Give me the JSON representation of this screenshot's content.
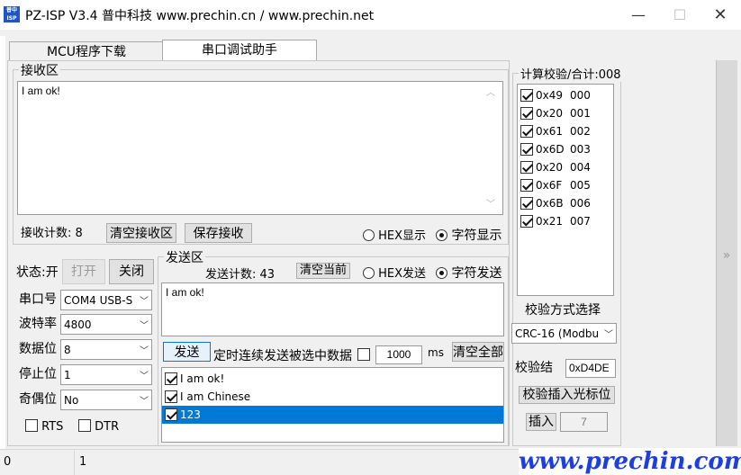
{
  "window": {
    "title": "PZ-ISP V3.4 普中科技 www.prechin.cn / www.prechin.net",
    "icon_text": "普中ISP",
    "min": "—",
    "max": "☐",
    "close": "✕"
  },
  "tabs": [
    "MCU程序下载",
    "串口调试助手"
  ],
  "receive": {
    "group_title": "接收区",
    "content": "I am ok!",
    "count_label": "接收计数: 8",
    "clear_button": "清空接收区",
    "save_button": "保存接收",
    "hex_label": "HEX显示",
    "char_label": "字符显示"
  },
  "send": {
    "group_title": "发送区",
    "count_label": "发送计数: 43",
    "clear_current_button": "清空当前",
    "hex_label": "HEX发送",
    "char_label": "字符发送",
    "content": "I am ok!",
    "send_button": "发送",
    "timer_label": "定时连续发送被选中数据",
    "interval_value": "1000",
    "interval_unit": "ms",
    "clear_all_button": "清空全部",
    "items": [
      {
        "label": "I am ok!",
        "checked": true,
        "selected": false
      },
      {
        "label": "I am Chinese",
        "checked": true,
        "selected": false
      },
      {
        "label": "123",
        "checked": true,
        "selected": true
      }
    ]
  },
  "port": {
    "status_label": "状态:开",
    "open_button": "打开",
    "close_button": "关闭",
    "fields": [
      {
        "label": "串口号",
        "value": "COM4  USB-S"
      },
      {
        "label": "波特率",
        "value": "4800"
      },
      {
        "label": "数据位",
        "value": "8"
      },
      {
        "label": "停止位",
        "value": "1"
      },
      {
        "label": "奇偶位",
        "value": "No"
      }
    ],
    "rts_label": "RTS",
    "dtr_label": "DTR"
  },
  "checksum": {
    "title": "计算校验/合计:008",
    "rows": [
      {
        "hex": "0x49",
        "idx": "000"
      },
      {
        "hex": "0x20",
        "idx": "001"
      },
      {
        "hex": "0x61",
        "idx": "002"
      },
      {
        "hex": "0x6D",
        "idx": "003"
      },
      {
        "hex": "0x20",
        "idx": "004"
      },
      {
        "hex": "0x6F",
        "idx": "005"
      },
      {
        "hex": "0x6B",
        "idx": "006"
      },
      {
        "hex": "0x21",
        "idx": "007"
      }
    ],
    "method_label": "校验方式选择",
    "method_value": "CRC-16 (Modbu",
    "result_label": "校验结",
    "result_value": "0xD4DE",
    "insert_cursor_button": "校验插入光标位",
    "insert_button": "插入",
    "insert_value": "7"
  },
  "statusbar": {
    "left": "0",
    "right": "1"
  },
  "brand": "www.prechin.com",
  "scroll_arrows": "»",
  "colors": {
    "selection": "#0078d7",
    "brand": "#1d3fe0"
  }
}
